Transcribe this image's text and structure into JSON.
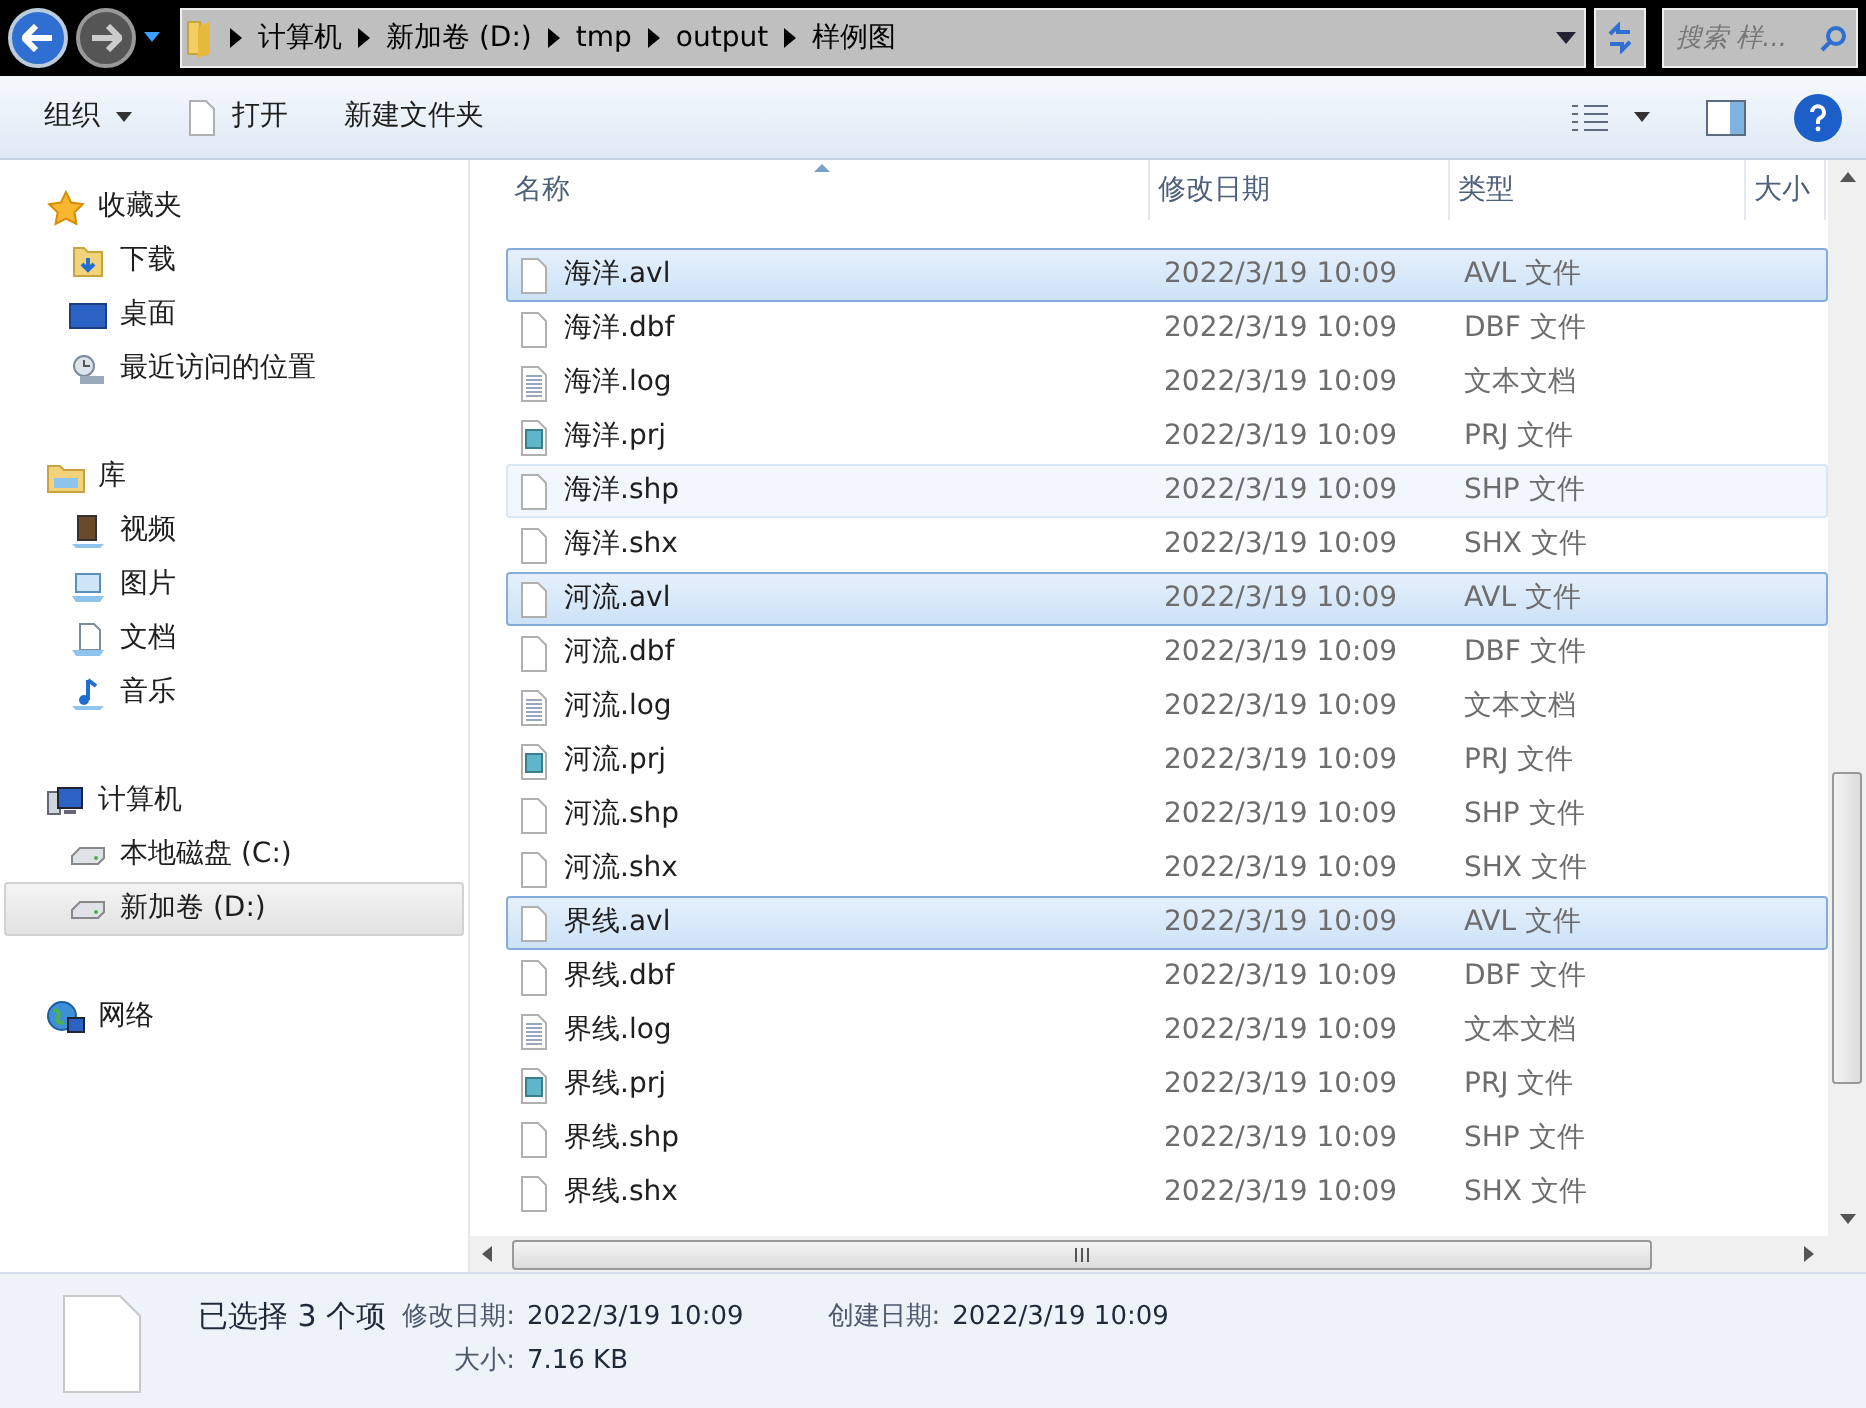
{
  "address_bar": {
    "crumbs": [
      "计算机",
      "新加卷 (D:)",
      "tmp",
      "output",
      "样例图"
    ],
    "search_placeholder": "搜索 样..."
  },
  "toolbar": {
    "items": [
      {
        "label": "组织",
        "dropdown": true
      },
      {
        "label": "打开",
        "dropdown": false
      },
      {
        "label": "新建文件夹",
        "dropdown": false
      }
    ]
  },
  "sidebar": {
    "groups": [
      {
        "label": "收藏夹",
        "children": [
          {
            "label": "下载",
            "selected": false
          },
          {
            "label": "桌面",
            "selected": false
          },
          {
            "label": "最近访问的位置",
            "selected": false
          }
        ]
      },
      {
        "label": "库",
        "children": [
          {
            "label": "视频",
            "selected": false
          },
          {
            "label": "图片",
            "selected": false
          },
          {
            "label": "文档",
            "selected": false
          },
          {
            "label": "音乐",
            "selected": false
          }
        ]
      },
      {
        "label": "计算机",
        "children": [
          {
            "label": "本地磁盘 (C:)",
            "selected": false
          },
          {
            "label": "新加卷 (D:)",
            "selected": true
          }
        ]
      },
      {
        "label": "网络"
      }
    ]
  },
  "table": {
    "columns": [
      "名称",
      "修改日期",
      "类型",
      "大小"
    ],
    "rows": [
      {
        "name": "海洋.avl",
        "date": "2022/3/19 10:09",
        "type": "AVL 文件",
        "kind": "blank",
        "selected": true,
        "hovered": false
      },
      {
        "name": "海洋.dbf",
        "date": "2022/3/19 10:09",
        "type": "DBF 文件",
        "kind": "blank",
        "selected": false,
        "hovered": false
      },
      {
        "name": "海洋.log",
        "date": "2022/3/19 10:09",
        "type": "文本文档",
        "kind": "text",
        "selected": false,
        "hovered": false
      },
      {
        "name": "海洋.prj",
        "date": "2022/3/19 10:09",
        "type": "PRJ 文件",
        "kind": "prj",
        "selected": false,
        "hovered": false
      },
      {
        "name": "海洋.shp",
        "date": "2022/3/19 10:09",
        "type": "SHP 文件",
        "kind": "blank",
        "selected": false,
        "hovered": true
      },
      {
        "name": "海洋.shx",
        "date": "2022/3/19 10:09",
        "type": "SHX 文件",
        "kind": "blank",
        "selected": false,
        "hovered": false
      },
      {
        "name": "河流.avl",
        "date": "2022/3/19 10:09",
        "type": "AVL 文件",
        "kind": "blank",
        "selected": true,
        "hovered": false
      },
      {
        "name": "河流.dbf",
        "date": "2022/3/19 10:09",
        "type": "DBF 文件",
        "kind": "blank",
        "selected": false,
        "hovered": false
      },
      {
        "name": "河流.log",
        "date": "2022/3/19 10:09",
        "type": "文本文档",
        "kind": "text",
        "selected": false,
        "hovered": false
      },
      {
        "name": "河流.prj",
        "date": "2022/3/19 10:09",
        "type": "PRJ 文件",
        "kind": "prj",
        "selected": false,
        "hovered": false
      },
      {
        "name": "河流.shp",
        "date": "2022/3/19 10:09",
        "type": "SHP 文件",
        "kind": "blank",
        "selected": false,
        "hovered": false
      },
      {
        "name": "河流.shx",
        "date": "2022/3/19 10:09",
        "type": "SHX 文件",
        "kind": "blank",
        "selected": false,
        "hovered": false
      },
      {
        "name": "界线.avl",
        "date": "2022/3/19 10:09",
        "type": "AVL 文件",
        "kind": "blank",
        "selected": true,
        "hovered": false
      },
      {
        "name": "界线.dbf",
        "date": "2022/3/19 10:09",
        "type": "DBF 文件",
        "kind": "blank",
        "selected": false,
        "hovered": false
      },
      {
        "name": "界线.log",
        "date": "2022/3/19 10:09",
        "type": "文本文档",
        "kind": "text",
        "selected": false,
        "hovered": false
      },
      {
        "name": "界线.prj",
        "date": "2022/3/19 10:09",
        "type": "PRJ 文件",
        "kind": "prj",
        "selected": false,
        "hovered": false
      },
      {
        "name": "界线.shp",
        "date": "2022/3/19 10:09",
        "type": "SHP 文件",
        "kind": "blank",
        "selected": false,
        "hovered": false
      },
      {
        "name": "界线.shx",
        "date": "2022/3/19 10:09",
        "type": "SHX 文件",
        "kind": "blank",
        "selected": false,
        "hovered": false
      }
    ]
  },
  "details": {
    "summary": "已选择 3 个项",
    "fields": [
      {
        "label": "修改日期:",
        "value": "2022/3/19 10:09"
      },
      {
        "label": "创建日期:",
        "value": "2022/3/19 10:09"
      },
      {
        "label": "大小:",
        "value": "7.16 KB"
      }
    ]
  }
}
